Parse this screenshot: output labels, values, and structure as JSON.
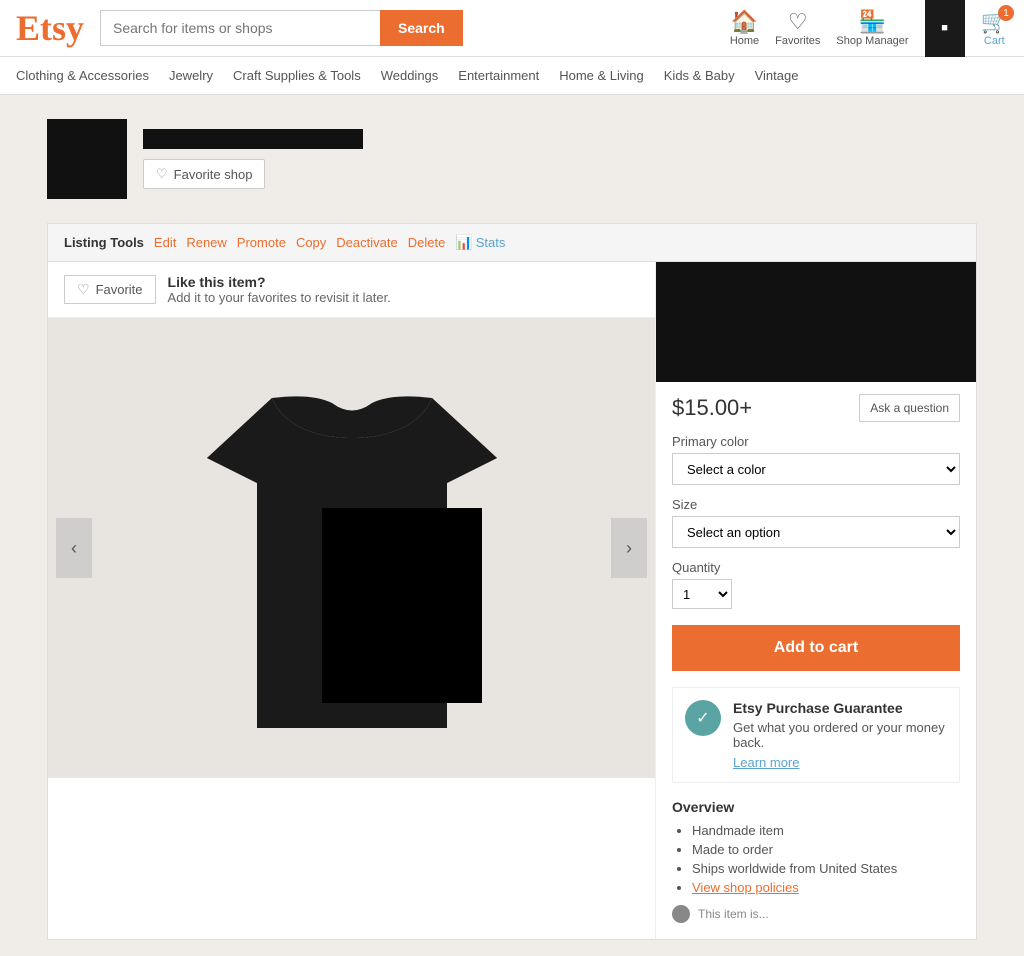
{
  "header": {
    "logo": "Etsy",
    "search_placeholder": "Search for items or shops",
    "search_button": "Search",
    "nav_items": [
      {
        "id": "home",
        "label": "Home",
        "icon": "🏠"
      },
      {
        "id": "favorites",
        "label": "Favorites",
        "icon": "♡"
      },
      {
        "id": "shop-manager",
        "label": "Shop Manager",
        "icon": "🏪",
        "badge": null
      },
      {
        "id": "cart",
        "label": "Cart",
        "icon": "🛒",
        "badge": "1"
      }
    ],
    "shop_manager_label": "Shop Manager"
  },
  "nav": {
    "items": [
      {
        "id": "clothing",
        "label": "Clothing & Accessories"
      },
      {
        "id": "jewelry",
        "label": "Jewelry"
      },
      {
        "id": "craft",
        "label": "Craft Supplies & Tools"
      },
      {
        "id": "weddings",
        "label": "Weddings"
      },
      {
        "id": "entertainment",
        "label": "Entertainment"
      },
      {
        "id": "home-living",
        "label": "Home & Living"
      },
      {
        "id": "kids-baby",
        "label": "Kids & Baby"
      },
      {
        "id": "vintage",
        "label": "Vintage"
      }
    ]
  },
  "shop": {
    "favorite_shop_btn": "Favorite shop"
  },
  "listing_tools": {
    "label": "Listing Tools",
    "actions": [
      {
        "id": "edit",
        "label": "Edit"
      },
      {
        "id": "renew",
        "label": "Renew"
      },
      {
        "id": "promote",
        "label": "Promote"
      },
      {
        "id": "copy",
        "label": "Copy"
      },
      {
        "id": "deactivate",
        "label": "Deactivate"
      },
      {
        "id": "delete",
        "label": "Delete"
      },
      {
        "id": "stats",
        "label": "Stats"
      }
    ]
  },
  "favorite": {
    "button_label": "Favorite",
    "title": "Like this item?",
    "subtitle": "Add it to your favorites to revisit it later."
  },
  "product": {
    "price": "$15.00+",
    "ask_question_btn": "Ask a question",
    "primary_color_label": "Primary color",
    "primary_color_placeholder": "Select a color",
    "size_label": "Size",
    "size_placeholder": "Select an option",
    "quantity_label": "Quantity",
    "quantity_value": "1",
    "add_to_cart_btn": "Add to cart",
    "guarantee_title": "Etsy Purchase Guarantee",
    "guarantee_text": "Get what you ordered or your money back.",
    "guarantee_link": "Learn more",
    "overview_title": "Overview",
    "overview_items": [
      "Handmade item",
      "Made to order",
      "Ships worldwide from United States"
    ],
    "shop_policies_label": "View shop policies"
  }
}
